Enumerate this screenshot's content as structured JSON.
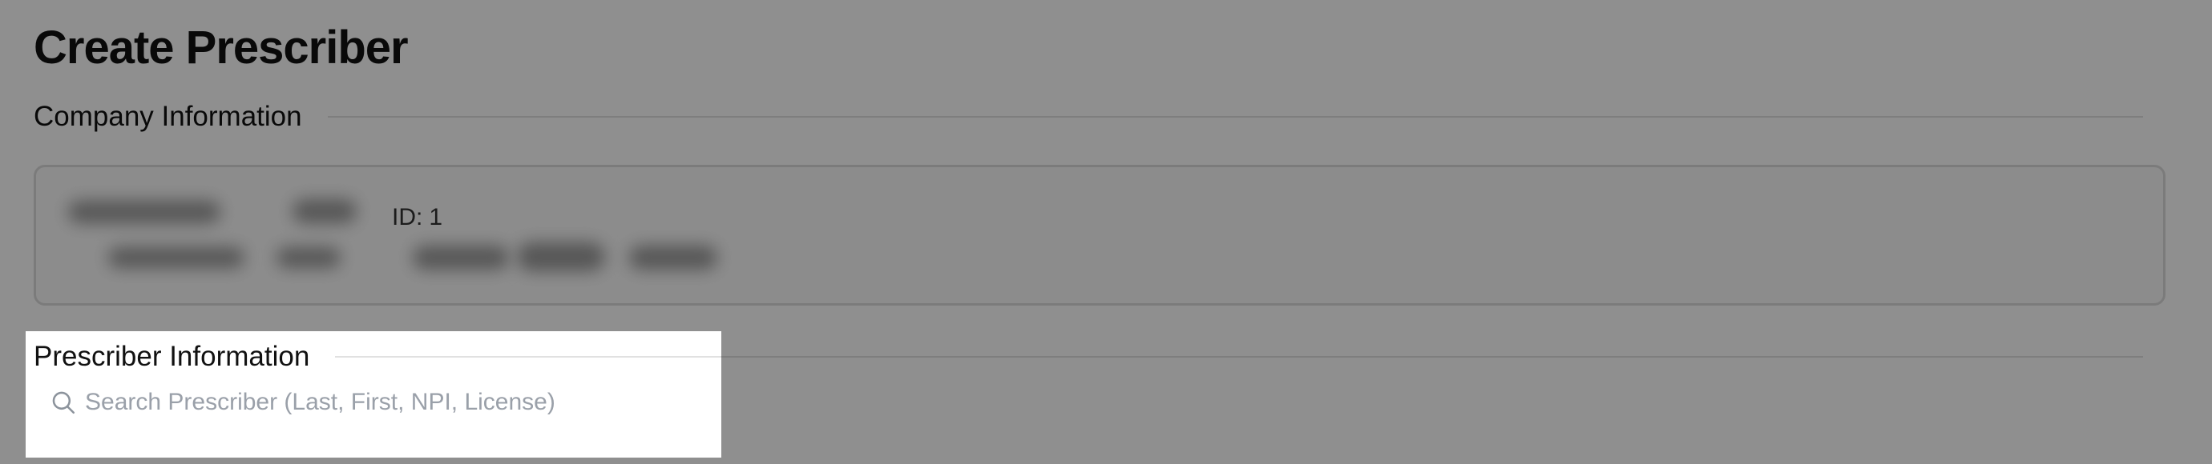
{
  "page": {
    "title": "Create Prescriber"
  },
  "company_section": {
    "title": "Company Information",
    "id_label": "ID:",
    "id_value": "1"
  },
  "prescriber_section": {
    "title": "Prescriber Information",
    "search_placeholder": "Search Prescriber (Last, First, NPI, License)",
    "search_value": ""
  },
  "icons": {
    "search": "search-icon"
  }
}
